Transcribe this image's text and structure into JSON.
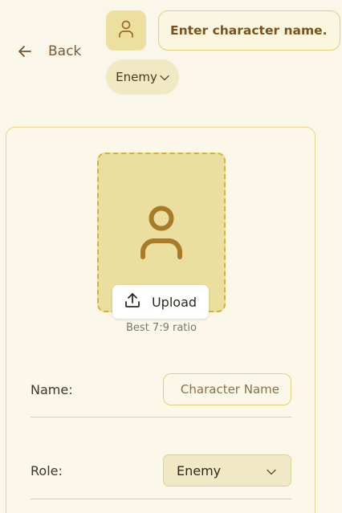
{
  "header": {
    "back_label": "Back",
    "name_placeholder": "Enter character name...",
    "role_pill_label": "Enemy"
  },
  "portrait": {
    "upload_label": "Upload",
    "hint": "Best 7:9 ratio"
  },
  "form": {
    "name_label": "Name:",
    "name_placeholder": "Character Name",
    "role_label": "Role:",
    "role_value": "Enemy"
  },
  "icons": {
    "back": "arrow-left-icon",
    "avatar": "user-icon",
    "portrait": "user-icon",
    "upload": "upload-icon",
    "dropdown": "chevron-down-icon"
  },
  "colors": {
    "background": "#faf7ea",
    "accent": "#b07d2a",
    "portrait_fill": "#eadf9e",
    "border": "#e2cf78"
  }
}
